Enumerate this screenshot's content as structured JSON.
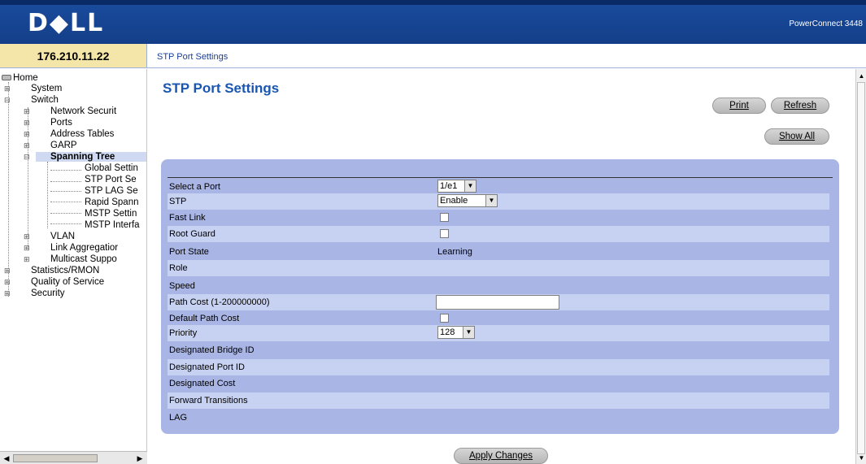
{
  "header": {
    "logo": "D◆LL",
    "product": "PowerConnect 3448"
  },
  "ip_address": "176.210.11.22",
  "breadcrumb": "STP Port Settings",
  "tree": {
    "home": "Home",
    "system": "System",
    "switch": "Switch",
    "network_security": "Network Securit",
    "ports": "Ports",
    "address_tables": "Address Tables",
    "garp": "GARP",
    "spanning_tree": "Spanning Tree",
    "global_settings": "Global Settin",
    "stp_port_settings": "STP Port Se",
    "stp_lag_settings": "STP LAG Se",
    "rapid_spanning": "Rapid Spann",
    "mstp_settings": "MSTP Settin",
    "mstp_interface": "MSTP Interfa",
    "vlan": "VLAN",
    "link_aggregation": "Link Aggregatior",
    "multicast_support": "Multicast Suppo",
    "statistics_rmon": "Statistics/RMON",
    "quality_of_service": "Quality of Service",
    "security": "Security"
  },
  "page_title": "STP Port Settings",
  "buttons": {
    "print": "Print",
    "refresh": "Refresh",
    "show_all": "Show All",
    "apply_changes": "Apply Changes"
  },
  "form": {
    "select_port_label": "Select a Port",
    "select_port_value": "1/e1",
    "stp_label": "STP",
    "stp_value": "Enable",
    "fast_link_label": "Fast Link",
    "root_guard_label": "Root Guard",
    "port_state_label": "Port State",
    "port_state_value": "Learning",
    "role_label": "Role",
    "speed_label": "Speed",
    "path_cost_label": "Path Cost (1-200000000)",
    "path_cost_value": "",
    "default_path_cost_label": "Default Path Cost",
    "priority_label": "Priority",
    "priority_value": "128",
    "designated_bridge_id_label": "Designated Bridge ID",
    "designated_port_id_label": "Designated Port ID",
    "designated_cost_label": "Designated Cost",
    "forward_transitions_label": "Forward Transitions",
    "lag_label": "LAG"
  },
  "colors": {
    "header_blue": "#1a4c9e",
    "panel_blue": "#a9b5e4",
    "row_alt_blue": "#c7d1f1",
    "ip_box_yellow": "#f3e6a8",
    "title_blue": "#1a56b0"
  }
}
